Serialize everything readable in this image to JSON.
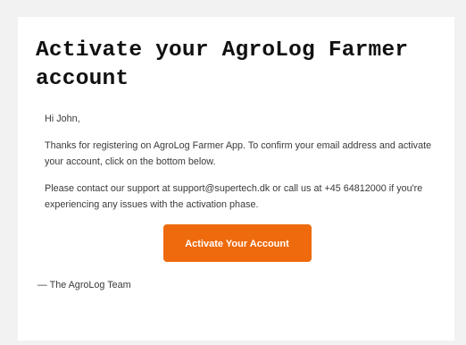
{
  "email": {
    "title": "Activate your AgroLog Farmer account",
    "greeting": "Hi John,",
    "paragraph1": "Thanks for registering on AgroLog Farmer App. To confirm your email address and activate your account, click on the bottom below.",
    "paragraph2": "Please contact our support at support@supertech.dk or call us at +45 64812000 if you're experiencing any issues with the activation phase.",
    "cta_label": "Activate Your Account",
    "signature": "— The AgroLog Team"
  },
  "colors": {
    "accent": "#ee6a0c",
    "page_background": "#f2f2f2",
    "card_background": "#ffffff"
  }
}
